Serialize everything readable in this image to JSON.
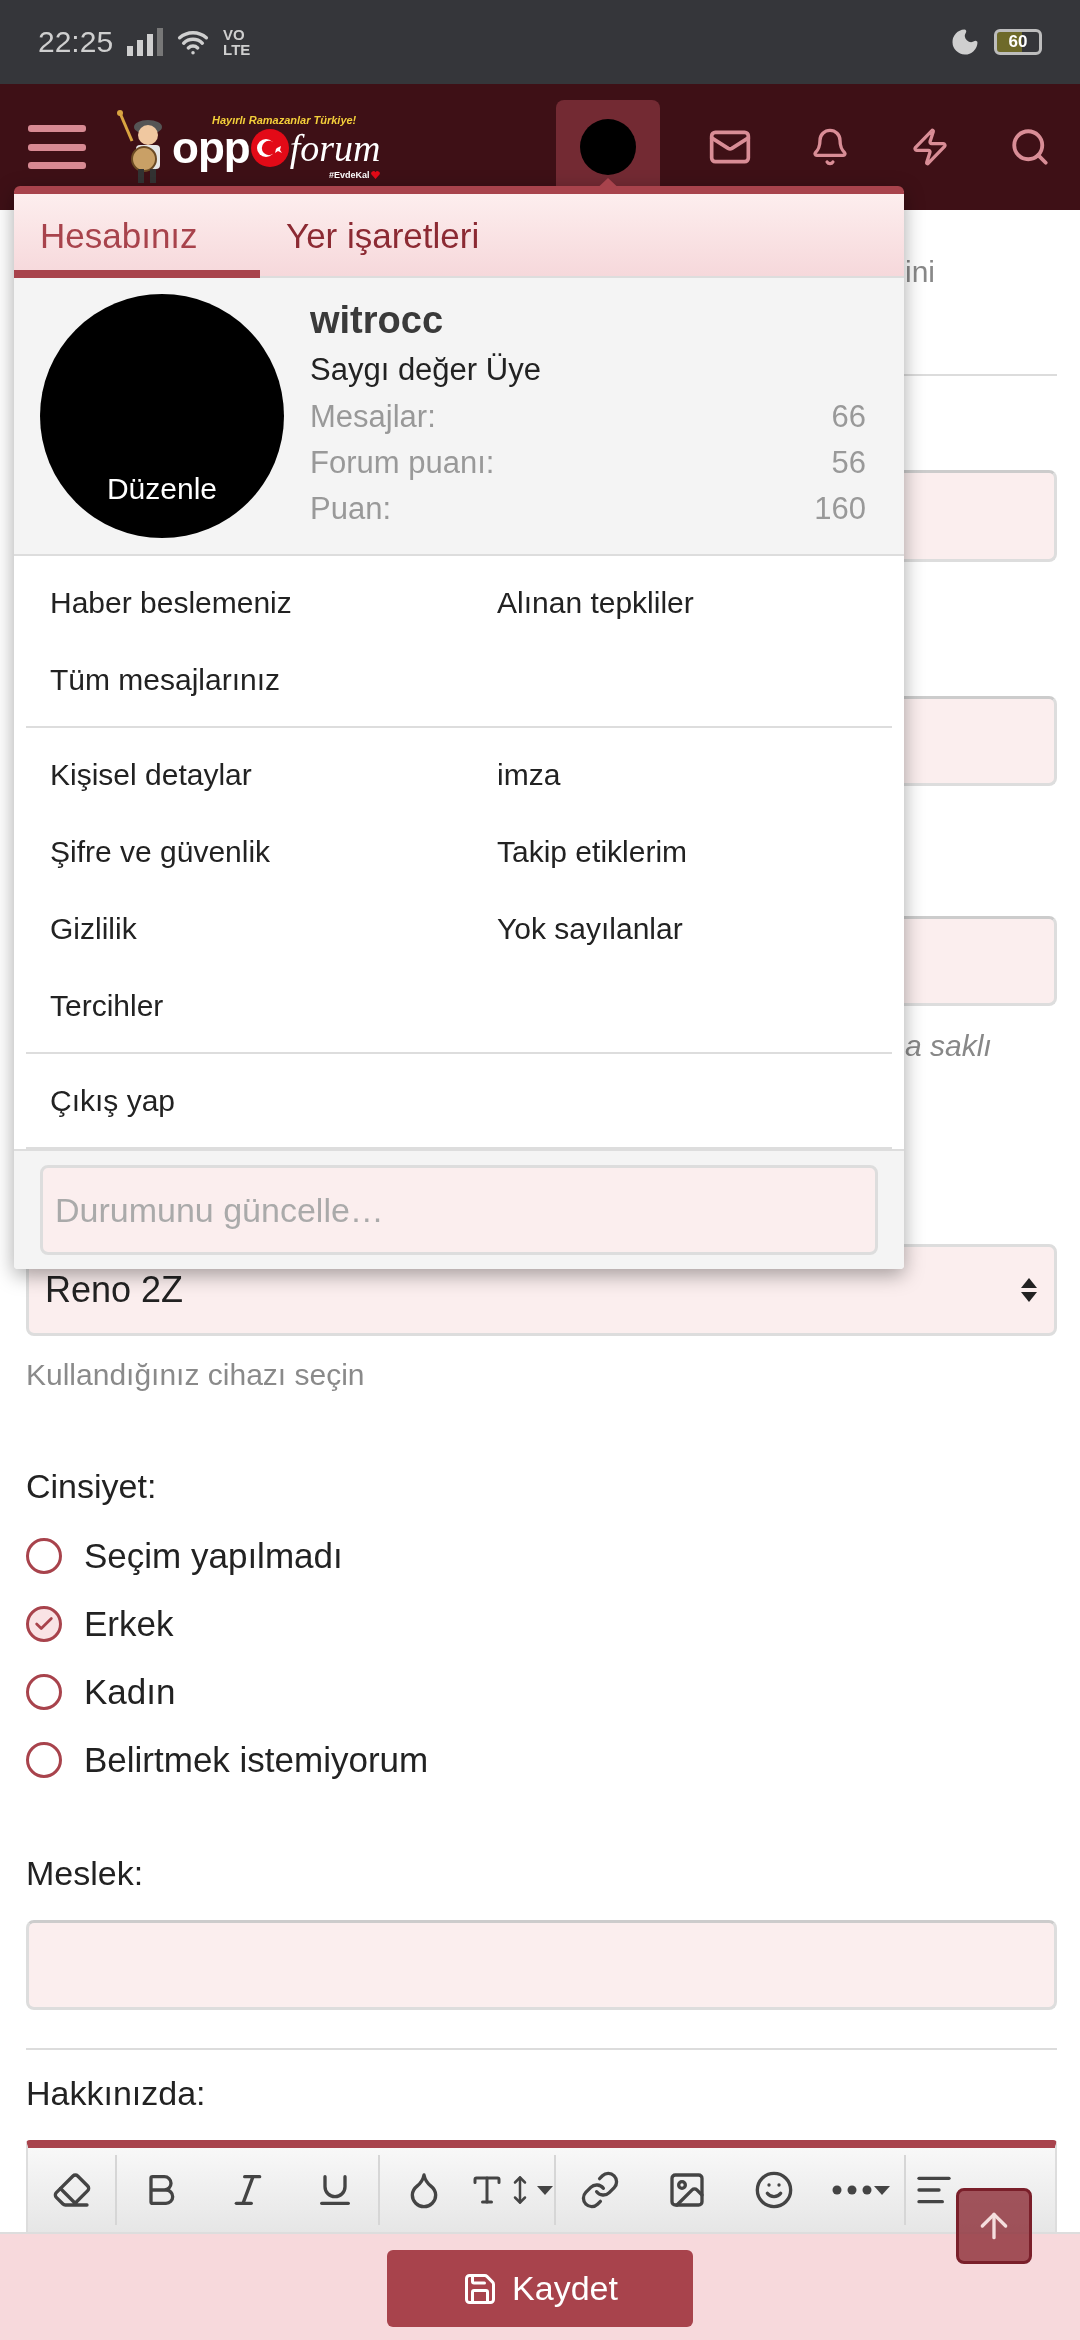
{
  "status_bar": {
    "time": "22:25",
    "network": [
      "VO",
      "LTE"
    ],
    "battery": "60"
  },
  "header": {
    "logo": {
      "tagline": "Hayırlı Ramazanlar Türkiye!",
      "name_start": "opp",
      "name_end": "forum",
      "hashtag": "#EvdeKal"
    },
    "account_open": true
  },
  "account_menu": {
    "tabs": [
      {
        "label": "Hesabınız",
        "selected": true
      },
      {
        "label": "Yer işaretleri",
        "selected": false
      }
    ],
    "profile": {
      "avatar_action": "Düzenle",
      "username": "witrocc",
      "title": "Saygı değer Üye",
      "stats": [
        {
          "label": "Mesajlar:",
          "value": "66"
        },
        {
          "label": "Forum puanı:",
          "value": "56"
        },
        {
          "label": "Puan:",
          "value": "160"
        }
      ]
    },
    "link_groups": [
      [
        "Haber beslemeniz",
        "Alınan tepkliler",
        "Tüm mesajlarınız"
      ],
      [
        "Kişisel detaylar",
        "imza",
        "Şifre ve güvenlik",
        "Takip etiklerim",
        "Gizlilik",
        "Yok sayılanlar",
        "Tercihler"
      ],
      [
        "Çıkış yap"
      ]
    ],
    "status_field": {
      "placeholder": "Durumunu güncelle…"
    }
  },
  "covered_form": {
    "hint_fragment": "ini",
    "note_fragment": "a saklı"
  },
  "device": {
    "value": "Reno 2Z",
    "hint": "Kullandığınız cihazı seçin"
  },
  "gender": {
    "label": "Cinsiyet:",
    "options": [
      {
        "label": "Seçim yapılmadı",
        "selected": false
      },
      {
        "label": "Erkek",
        "selected": true
      },
      {
        "label": "Kadın",
        "selected": false
      },
      {
        "label": "Belirtmek istemiyorum",
        "selected": false
      }
    ]
  },
  "occupation": {
    "label": "Meslek:"
  },
  "about": {
    "label": "Hakkınızda:"
  },
  "save_button": "Kaydet"
}
